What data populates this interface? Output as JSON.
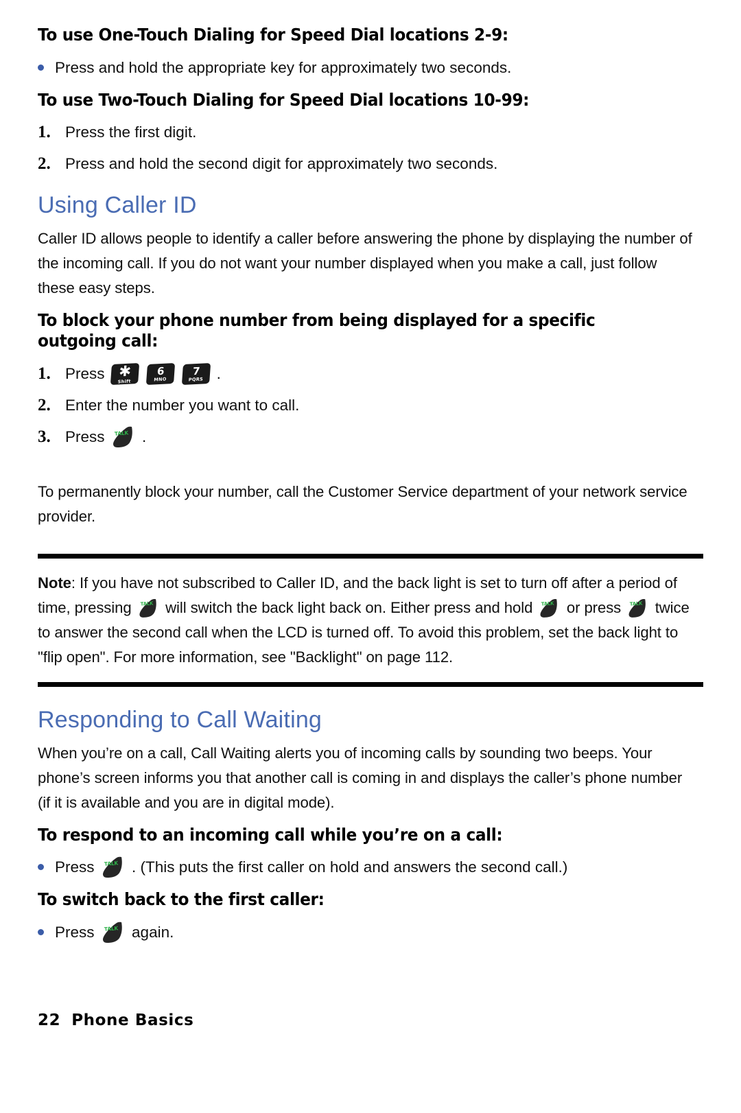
{
  "document": {
    "page_number": "22",
    "footer_title": "Phone Basics"
  },
  "sections": [
    {
      "id": "one-touch",
      "heading": "To use One-Touch Dialing for Speed Dial locations 2-9:",
      "bullets": [
        "Press and hold the appropriate key for approximately two seconds."
      ]
    },
    {
      "id": "two-touch",
      "heading": "To use Two-Touch Dialing for Speed Dial locations 10-99:",
      "steps": [
        {
          "marker": "1.",
          "text": "Press the first digit."
        },
        {
          "marker": "2.",
          "text": "Press and hold the second digit for approximately two seconds."
        }
      ]
    }
  ],
  "caller_id": {
    "title": "Using Caller ID",
    "intro": "Caller ID allows people to identify a caller before answering the phone by displaying the number of the incoming call. If you do not want your number displayed when you make a call, just follow these easy steps.",
    "procedure_heading": "To block your phone number from being displayed for a specific outgoing call:",
    "steps": [
      {
        "marker": "1.",
        "prefix": "Press",
        "suffix": "."
      },
      {
        "marker": "2.",
        "text": "Enter the number you want to call."
      },
      {
        "marker": "3.",
        "prefix": "Press",
        "suffix": "."
      }
    ],
    "closing": "To permanently block your number, call the Customer Service department of your network service provider."
  },
  "keys": [
    {
      "name": "star-key",
      "main": "✱",
      "sub": "Shift"
    },
    {
      "name": "six-key",
      "main": "6",
      "sub": "MNO"
    },
    {
      "name": "seven-key",
      "main": "7",
      "sub": "PQRS"
    }
  ],
  "talk_key": {
    "label": "TALK",
    "color": "#2fb14a"
  },
  "note": {
    "label": "Note",
    "part1": ": If you have not subscribed to Caller ID, and the back light is set to turn off after a period of time, pressing",
    "part2": "will switch the back light back on. Either press and hold",
    "part3": "or press",
    "part4": "twice to answer the second call when the LCD is turned off. To avoid this problem, set the back light to \"flip open\". For more information, see \"Backlight\" on page 112."
  },
  "call_waiting": {
    "title": "Responding to Call Waiting",
    "intro": "When you’re on a call, Call Waiting alerts you of incoming calls by sounding two beeps. Your phone’s screen informs you that another call is coming in and displays the caller’s phone number (if it is available and you are in digital mode).",
    "respond_heading": "To respond to an incoming call while you’re on a call:",
    "respond_bullet_prefix": "Press",
    "respond_bullet_suffix": ". (This puts the first caller on hold and answers the second call.)",
    "switch_heading": "To switch back to the first caller:",
    "switch_bullet_prefix": "Press",
    "switch_bullet_suffix": "again."
  },
  "colors": {
    "heading_blue": "#4a6cb3",
    "bullet_blue": "#3b5ca8",
    "rule_black": "#000000",
    "talk_green": "#2fb14a"
  }
}
